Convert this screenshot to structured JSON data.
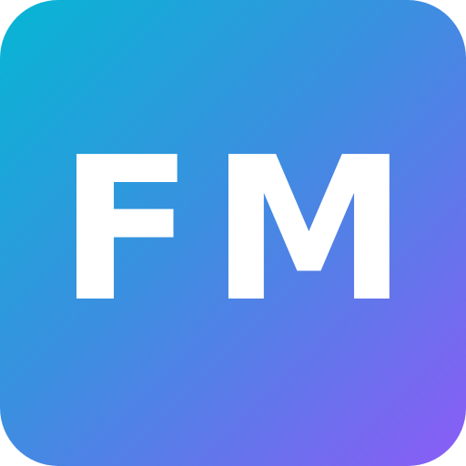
{
  "app_icon": {
    "monogram": "FM",
    "colors": {
      "gradient_start": "#06b6d4",
      "gradient_mid": "#3b8fe0",
      "gradient_end": "#8b5cf6",
      "text": "#ffffff"
    }
  }
}
